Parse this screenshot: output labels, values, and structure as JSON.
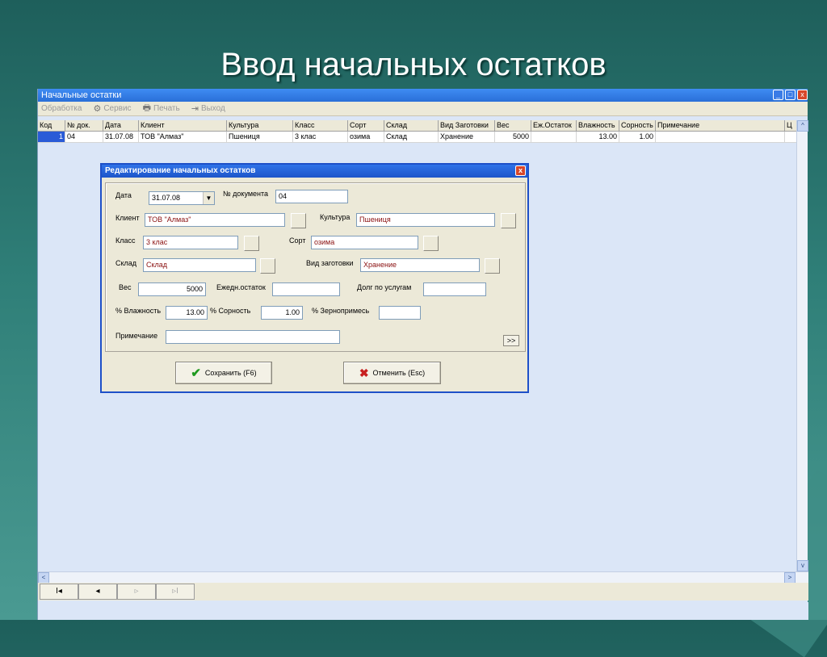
{
  "slide": {
    "title": "Ввод начальных остатков"
  },
  "app": {
    "window_title": "Начальные остатки",
    "window_buttons": {
      "minimize": "_",
      "maximize": "□",
      "close": "x"
    },
    "menu": [
      {
        "label": "Обработка",
        "icon": ""
      },
      {
        "label": "Сервис",
        "icon": "⚙"
      },
      {
        "label": "Печать",
        "icon": "🖶"
      },
      {
        "label": "Выход",
        "icon": "⇥"
      }
    ],
    "grid": {
      "columns": [
        "Код",
        "№ док.",
        "Дата",
        "Клиент",
        "Культура",
        "Класс",
        "Сорт",
        "Склад",
        "Вид Заготовки",
        "Вес",
        "Еж.Остаток",
        "Влажность",
        "Сорность",
        "Примечание",
        "Ц"
      ],
      "rows": [
        [
          "1",
          "04",
          "31.07.08",
          "ТОВ \"Алмаз\"",
          "Пшениця",
          "3 клас",
          "озима",
          "Склад",
          "Хранение",
          "5000",
          "",
          "13.00",
          "1.00",
          "",
          ""
        ]
      ]
    },
    "scroll": {
      "up": "^",
      "down": "v",
      "left": "<",
      "right": ">"
    },
    "nav": {
      "first": "I◂",
      "prev": "◂",
      "next": "▹",
      "last": "▹I"
    }
  },
  "dialog": {
    "title": "Редактирование начальных остатков",
    "close": "x",
    "labels": {
      "date": "Дата",
      "doc_no": "№ документа",
      "client": "Клиент",
      "culture": "Культура",
      "class": "Класс",
      "sort": "Сорт",
      "warehouse": "Склад",
      "procurement": "Вид заготовки",
      "weight": "Вес",
      "daily_balance": "Ежедн.остаток",
      "service_debt": "Долг по услугам",
      "humidity": "% Влажность",
      "weediness": "% Сорность",
      "grain_impurity": "% Зернопримесь",
      "note": "Примечание"
    },
    "values": {
      "date": "31.07.08",
      "doc_no": "04",
      "client": "ТОВ \"Алмаз\"",
      "culture": "Пшениця",
      "class": "3 клас",
      "sort": "озима",
      "warehouse": "Склад",
      "procurement": "Хранение",
      "weight": "5000",
      "daily_balance": "",
      "service_debt": "",
      "humidity": "13.00",
      "weediness": "1.00",
      "grain_impurity": "",
      "note": ""
    },
    "dropdown_arrow": "▼",
    "more": ">>",
    "save_label": "Сохранить (F6)",
    "cancel_label": "Отменить (Esc)",
    "save_icon": "✔",
    "cancel_icon": "✖"
  }
}
